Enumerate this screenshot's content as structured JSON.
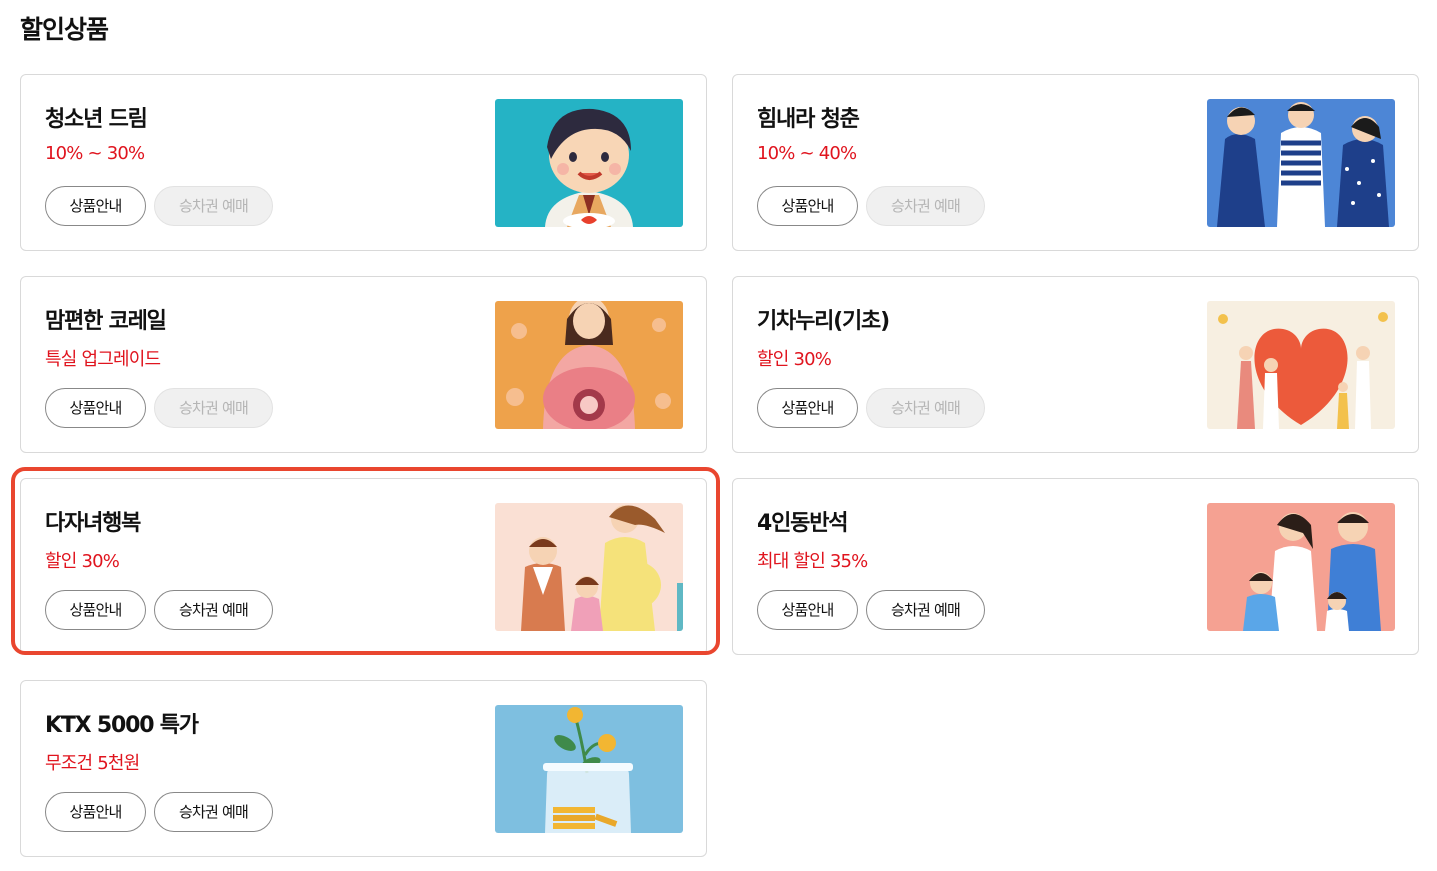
{
  "page": {
    "title": "할인상품"
  },
  "products": [
    {
      "title": "청소년 드림",
      "rate": "10% ~ 30%",
      "info_label": "상품안내",
      "reserve_label": "승차권 예매",
      "reserve_enabled": false,
      "image": "teen-illustration"
    },
    {
      "title": "힘내라 청춘",
      "rate": "10% ~ 40%",
      "info_label": "상품안내",
      "reserve_label": "승차권 예매",
      "reserve_enabled": false,
      "image": "youth-friends-illustration"
    },
    {
      "title": "맘편한 코레일",
      "rate": "특실 업그레이드",
      "info_label": "상품안내",
      "reserve_label": "승차권 예매",
      "reserve_enabled": false,
      "image": "pregnant-mother-illustration"
    },
    {
      "title": "기차누리(기초)",
      "rate": "할인 30%",
      "info_label": "상품안내",
      "reserve_label": "승차권 예매",
      "reserve_enabled": false,
      "image": "heart-family-illustration"
    },
    {
      "title": "다자녀행복",
      "rate": "할인 30%",
      "info_label": "상품안내",
      "reserve_label": "승차권 예매",
      "reserve_enabled": true,
      "image": "multi-child-family-illustration"
    },
    {
      "title": "4인동반석",
      "rate": "최대 할인 35%",
      "info_label": "상품안내",
      "reserve_label": "승차권 예매",
      "reserve_enabled": true,
      "image": "family-of-four-illustration"
    },
    {
      "title": "KTX 5000 특가",
      "rate": "무조건 5천원",
      "info_label": "상품안내",
      "reserve_label": "승차권 예매",
      "reserve_enabled": true,
      "image": "coin-jar-illustration"
    }
  ],
  "colors": {
    "accent_red": "#e0141e",
    "highlight_frame": "#e9462f",
    "card_border": "#d9d9d9",
    "disabled_button_bg": "#f0f0f0",
    "disabled_button_text": "#b5b5b5"
  }
}
